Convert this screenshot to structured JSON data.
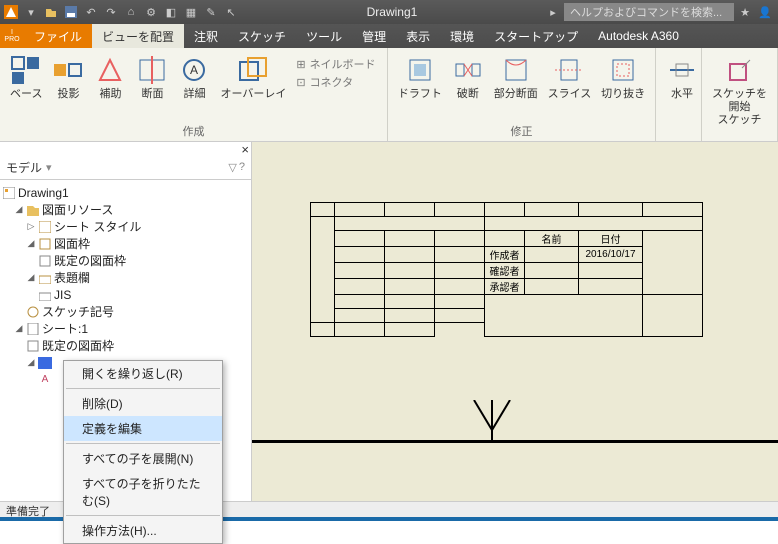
{
  "titlebar": {
    "doc_title": "Drawing1",
    "search_placeholder": "ヘルプおよびコマンドを検索..."
  },
  "menubar": {
    "items": [
      "ファイル",
      "ビューを配置",
      "注釈",
      "スケッチ",
      "ツール",
      "管理",
      "表示",
      "環境",
      "スタートアップ",
      "Autodesk A360"
    ],
    "pro": "PRO"
  },
  "ribbon": {
    "create_group": "作成",
    "modify_group": "修正",
    "create": [
      {
        "label": "ベース"
      },
      {
        "label": "投影"
      },
      {
        "label": "補助"
      },
      {
        "label": "断面"
      },
      {
        "label": "詳細"
      },
      {
        "label": "オーバーレイ"
      }
    ],
    "nailboard": "ネイルボード",
    "connector": "コネクタ",
    "modify": [
      {
        "label": "ドラフト"
      },
      {
        "label": "破断"
      },
      {
        "label": "部分断面"
      },
      {
        "label": "スライス"
      },
      {
        "label": "切り抜き"
      }
    ],
    "horizontal": "水平",
    "start_sketch": "スケッチを\n開始\nスケッチ"
  },
  "panel": {
    "title": "モデル",
    "tree": {
      "root": "Drawing1",
      "resources": "図面リソース",
      "sheet_style": "シート スタイル",
      "frame": "図面枠",
      "default_frame": "既定の図面枠",
      "titleblock": "表題欄",
      "jis": "JIS",
      "sketch_sym": "スケッチ記号",
      "sheet1": "シート:1",
      "default_frame2": "既定の図面枠"
    }
  },
  "context_menu": {
    "open_repeat": "開くを繰り返し(R)",
    "delete": "削除(D)",
    "edit_def": "定義を編集",
    "expand_all": "すべての子を展開(N)",
    "collapse_all": "すべての子を折りたたむ(S)",
    "how_to": "操作方法(H)..."
  },
  "titleblock_data": {
    "name_hdr": "名前",
    "date_hdr": "日付",
    "creator": "作成者",
    "checker": "確認者",
    "approver": "承認者",
    "date": "2016/10/17"
  },
  "status": {
    "ready": "準備完了"
  }
}
